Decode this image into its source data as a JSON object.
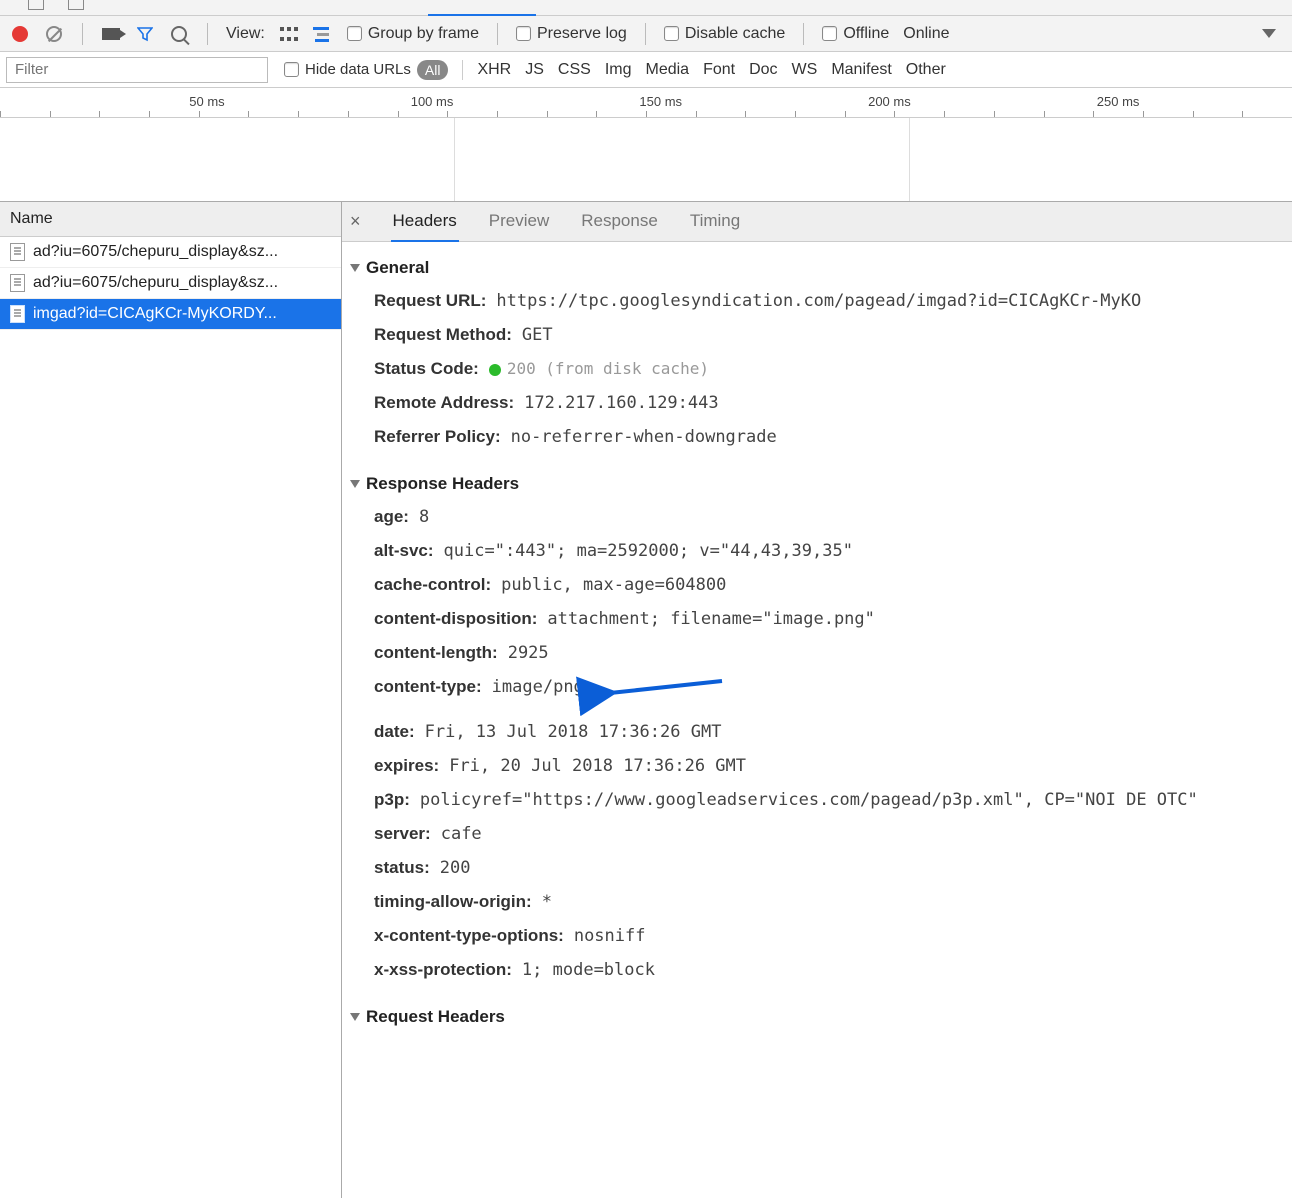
{
  "toolbar": {
    "view_label": "View:",
    "group_by_frame": "Group by frame",
    "preserve_log": "Preserve log",
    "disable_cache": "Disable cache",
    "offline": "Offline",
    "online": "Online"
  },
  "filter": {
    "placeholder": "Filter",
    "hide_data_urls": "Hide data URLs",
    "types": [
      "All",
      "XHR",
      "JS",
      "CSS",
      "Img",
      "Media",
      "Font",
      "Doc",
      "WS",
      "Manifest",
      "Other"
    ],
    "selected_type": "All"
  },
  "timeline": {
    "ticks": [
      "50 ms",
      "100 ms",
      "150 ms",
      "200 ms",
      "250 ms"
    ]
  },
  "name_panel": {
    "header": "Name",
    "rows": [
      {
        "label": "ad?iu=6075/chepuru_display&sz...",
        "selected": false
      },
      {
        "label": "ad?iu=6075/chepuru_display&sz...",
        "selected": false
      },
      {
        "label": "imgad?id=CICAgKCr-MyKORDY...",
        "selected": true
      }
    ]
  },
  "detail": {
    "tabs": [
      "Headers",
      "Preview",
      "Response",
      "Timing"
    ],
    "active_tab": "Headers",
    "general": {
      "title": "General",
      "request_url": {
        "label": "Request URL:",
        "value": "https://tpc.googlesyndication.com/pagead/imgad?id=CICAgKCr-MyKO"
      },
      "request_method": {
        "label": "Request Method:",
        "value": "GET"
      },
      "status_code": {
        "label": "Status Code:",
        "value": "200",
        "extra": "(from disk cache)"
      },
      "remote_address": {
        "label": "Remote Address:",
        "value": "172.217.160.129:443"
      },
      "referrer_policy": {
        "label": "Referrer Policy:",
        "value": "no-referrer-when-downgrade"
      }
    },
    "response_headers": {
      "title": "Response Headers",
      "items": [
        {
          "k": "age:",
          "v": "8"
        },
        {
          "k": "alt-svc:",
          "v": "quic=\":443\"; ma=2592000; v=\"44,43,39,35\""
        },
        {
          "k": "cache-control:",
          "v": "public, max-age=604800"
        },
        {
          "k": "content-disposition:",
          "v": "attachment; filename=\"image.png\""
        },
        {
          "k": "content-length:",
          "v": "2925"
        },
        {
          "k": "content-type:",
          "v": "image/png",
          "arrow": true
        },
        {
          "k": "date:",
          "v": "Fri, 13 Jul 2018 17:36:26 GMT"
        },
        {
          "k": "expires:",
          "v": "Fri, 20 Jul 2018 17:36:26 GMT"
        },
        {
          "k": "p3p:",
          "v": "policyref=\"https://www.googleadservices.com/pagead/p3p.xml\", CP=\"NOI DE OTC\""
        },
        {
          "k": "server:",
          "v": "cafe"
        },
        {
          "k": "status:",
          "v": "200"
        },
        {
          "k": "timing-allow-origin:",
          "v": "*"
        },
        {
          "k": "x-content-type-options:",
          "v": "nosniff"
        },
        {
          "k": "x-xss-protection:",
          "v": "1; mode=block"
        }
      ]
    },
    "request_headers": {
      "title": "Request Headers"
    }
  }
}
